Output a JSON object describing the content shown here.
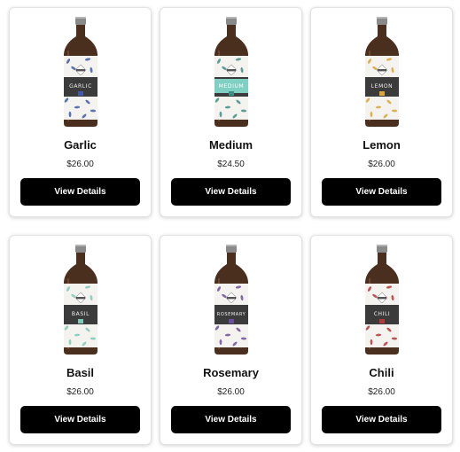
{
  "products": [
    {
      "name": "Garlic",
      "price": "$26.00",
      "button": "View Details",
      "label_text": "GARLIC",
      "accent": "#3e5aa8",
      "band": "#ffffff"
    },
    {
      "name": "Medium",
      "price": "$24.50",
      "button": "View Details",
      "label_text": "MEDIUM",
      "accent": "#3d8f86",
      "band": "#7fcfc2"
    },
    {
      "name": "Lemon",
      "price": "$26.00",
      "button": "View Details",
      "label_text": "LEMON",
      "accent": "#d8a63a",
      "band": "#ffffff"
    },
    {
      "name": "Basil",
      "price": "$26.00",
      "button": "View Details",
      "label_text": "BASIL",
      "accent": "#7ec9b8",
      "band": "#ffffff"
    },
    {
      "name": "Rosemary",
      "price": "$26.00",
      "button": "View Details",
      "label_text": "ROSEMARY",
      "accent": "#6b4f9e",
      "band": "#ffffff"
    },
    {
      "name": "Chili",
      "price": "$26.00",
      "button": "View Details",
      "label_text": "CHILI",
      "accent": "#b23a3a",
      "band": "#ffffff"
    }
  ]
}
